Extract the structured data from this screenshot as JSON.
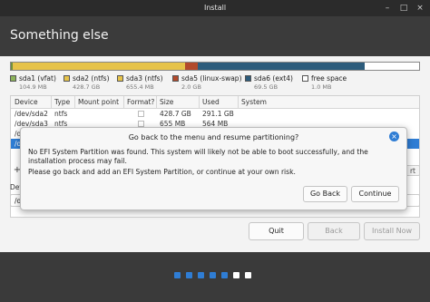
{
  "window": {
    "title": "Install"
  },
  "header": {
    "title": "Something else"
  },
  "partition_bar": {
    "segments": [
      {
        "label": "sda1 (vfat)",
        "color": "#6f8f3f"
      },
      {
        "label": "sda2 (ntfs)",
        "color": "#e6c34a"
      },
      {
        "label": "sda3 (ntfs)",
        "color": "#e6c34a"
      },
      {
        "label": "sda5 (linux-swap)",
        "color": "#b24a2c"
      },
      {
        "label": "sda6 (ext4)",
        "color": "#2d5c7c"
      },
      {
        "label": "free space",
        "color": "#ffffff"
      }
    ]
  },
  "legend": [
    {
      "name": "sda1 (vfat)",
      "size": "104.9 MB",
      "color": "#8cb35b"
    },
    {
      "name": "sda2 (ntfs)",
      "size": "428.7 GB",
      "color": "#e6c34a"
    },
    {
      "name": "sda3 (ntfs)",
      "size": "655.4 MB",
      "color": "#e6c34a"
    },
    {
      "name": "sda5 (linux-swap)",
      "size": "2.0 GB",
      "color": "#b24a2c"
    },
    {
      "name": "sda6 (ext4)",
      "size": "69.5 GB",
      "color": "#2d5c7c"
    },
    {
      "name": "free space",
      "size": "1.0 MB",
      "color": "#ffffff"
    }
  ],
  "table": {
    "columns": [
      "Device",
      "Type",
      "Mount point",
      "Format?",
      "Size",
      "Used",
      "System"
    ],
    "rows": [
      {
        "device": "/dev/sda2",
        "type": "ntfs",
        "mount": "",
        "size": "428.7 GB",
        "used": "291.1 GB",
        "system": ""
      },
      {
        "device": "/dev/sda3",
        "type": "ntfs",
        "mount": "",
        "size": "655 MB",
        "used": "564 MB",
        "system": ""
      },
      {
        "device": "/d",
        "type": "",
        "mount": "",
        "size": "",
        "used": "",
        "system": ""
      },
      {
        "device": "/d",
        "type": "",
        "mount": "",
        "size": "",
        "used": "",
        "system": ""
      }
    ]
  },
  "tools": {
    "add": "+",
    "revert": "rt"
  },
  "device_label": "Dev",
  "device_select": "/d",
  "actions": {
    "quit": "Quit",
    "back": "Back",
    "install": "Install Now"
  },
  "dialog": {
    "title": "Go back to the menu and resume partitioning?",
    "body1": "No EFI System Partition was found. This system will likely not be able to boot successfully, and the installation process may fail.",
    "body2": "Please go back and add an EFI System Partition, or continue at your own risk.",
    "go_back": "Go Back",
    "continue": "Continue"
  },
  "progress": {
    "steps": 7,
    "completed": 5,
    "active_color": "#2f7dd4",
    "inactive_color": "#ffffff"
  },
  "icons": {
    "close": "×",
    "maximize": "□",
    "minimize": "–",
    "dialog_close": "×"
  }
}
